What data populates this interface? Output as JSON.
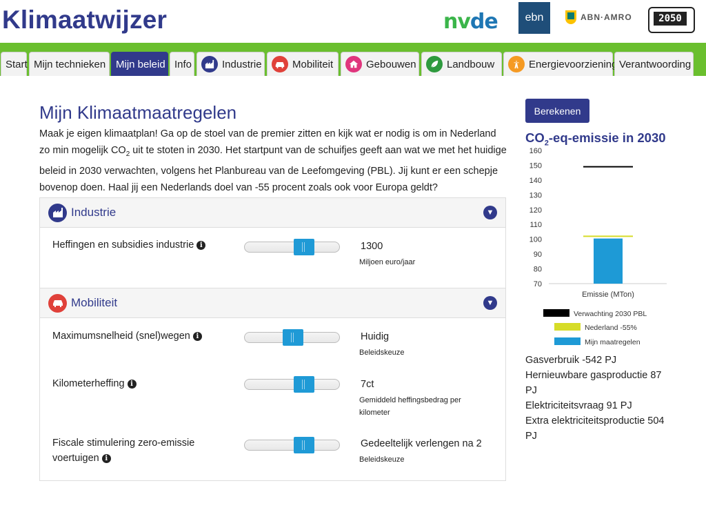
{
  "app_title": "Klimaatwijzer",
  "logos": {
    "nvde_a": "nv",
    "nvde_b": "de",
    "ebn": "ebn",
    "abn": "ABN·AMRO",
    "y2050": "2050"
  },
  "tabs": [
    {
      "label": "Start",
      "icon": null,
      "active": false
    },
    {
      "label": "Mijn technieken",
      "icon": null,
      "active": false
    },
    {
      "label": "Mijn beleid",
      "icon": null,
      "active": true
    },
    {
      "label": "Info",
      "icon": null,
      "active": false
    },
    {
      "label": "Industrie",
      "icon": "factory-icon",
      "color": "#313a8b",
      "active": false
    },
    {
      "label": "Mobiliteit",
      "icon": "car-icon",
      "color": "#e0413a",
      "active": false
    },
    {
      "label": "Gebouwen",
      "icon": "house-icon",
      "color": "#e0357d",
      "active": false
    },
    {
      "label": "Landbouw",
      "icon": "leaf-icon",
      "color": "#2e9a3e",
      "active": false
    },
    {
      "label": "Energievoorziening",
      "icon": "power-icon",
      "color": "#f59a23",
      "active": false
    },
    {
      "label": "Verantwoording",
      "icon": null,
      "active": false
    }
  ],
  "main": {
    "title": "Mijn Klimaatmaatregelen",
    "intro_1": "Maak je eigen klimaatplan! Ga op de stoel van de premier zitten en kijk wat er nodig is om in Nederland zo min mogelijk CO",
    "intro_sub": "2",
    "intro_2": " uit te stoten in 2030. Het startpunt van de schuifjes geeft aan wat we met het huidige beleid in 2030 verwachten, volgens het Planbureau van de Leefomgeving (PBL). Jij kunt er een schepje bovenop doen. Haal jij een Nederlands doel van -55 procent zoals ook voor Europa geldt?",
    "sections": [
      {
        "title": "Industrie",
        "icon": "factory-icon",
        "color": "#313a8b",
        "rows": [
          {
            "label": "Heffingen en subsidies industrie",
            "value": "1300",
            "sub": "Miljoen euro/jaar",
            "level": 0.65
          }
        ]
      },
      {
        "title": "Mobiliteit",
        "icon": "car-icon",
        "color": "#e0413a",
        "rows": [
          {
            "label": "Maximumsnelheid (snel)wegen",
            "value": "Huidig",
            "sub": "Beleidskeuze",
            "level": 0.5
          },
          {
            "label": "Kilometerheffing",
            "value": "7ct",
            "sub": "Gemiddeld heffingsbedrag per kilometer",
            "level": 0.65
          },
          {
            "label": "Fiscale stimulering zero-emissie voertuigen",
            "value": "Gedeeltelijk verlengen na 2",
            "sub": "Beleidskeuze",
            "level": 0.65
          }
        ]
      }
    ]
  },
  "sidebar": {
    "calc_button": "Berekenen",
    "chart_title_a": "CO",
    "chart_title_sub": "2",
    "chart_title_b": "-eq-emissie in 2030",
    "stats": [
      "Gasverbruik -542 PJ",
      "Hernieuwbare gasproductie 87 PJ",
      "Elektriciteitsvraag 91 PJ",
      "Extra elektriciteitsproductie 504 PJ"
    ]
  },
  "chart_data": {
    "type": "bar",
    "categories": [
      "Emissie (MTon)"
    ],
    "ylim": [
      70,
      160
    ],
    "yticks": [
      70,
      80,
      90,
      100,
      110,
      120,
      130,
      140,
      150,
      160
    ],
    "series": [
      {
        "name": "Verwachting 2030 PBL",
        "value": 149,
        "color": "#000000",
        "kind": "line"
      },
      {
        "name": "Nederland -55%",
        "value": 102,
        "color": "#d6dc28",
        "kind": "line"
      },
      {
        "name": "Mijn maatregelen",
        "value": 100.5,
        "color": "#1e9ad6",
        "kind": "bar"
      }
    ],
    "xlabel": "Emissie (MTon)",
    "legend": [
      "Verwachting 2030 PBL",
      "Nederland -55%",
      "Mijn maatregelen"
    ]
  }
}
